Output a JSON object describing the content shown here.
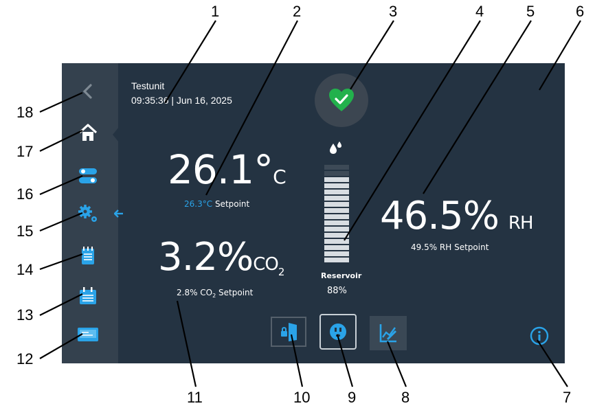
{
  "header": {
    "device_name": "Testunit",
    "datetime": "09:35:36 | Jun 16, 2025"
  },
  "temperature": {
    "value": "26.1°",
    "unit": "C",
    "setpoint_value": "26.3°C",
    "setpoint_label": "Setpoint"
  },
  "co2": {
    "value": "3.2%",
    "unit": "CO",
    "unit_sub": "2",
    "setpoint_prefix": "2.8% CO",
    "setpoint_sub": "2",
    "setpoint_suffix": " Setpoint"
  },
  "humidity": {
    "value": "46.5%",
    "unit": "RH",
    "setpoint": "49.5% RH Setpoint"
  },
  "reservoir": {
    "label": "Reservoir",
    "percent": "88%",
    "level_fraction": 0.88
  },
  "status": {
    "icon": "heart-check-icon",
    "color": "#22b14c"
  },
  "sidebar": {
    "items": [
      {
        "icon": "back-chevron-icon"
      },
      {
        "icon": "home-icon"
      },
      {
        "icon": "toggle-settings-icon"
      },
      {
        "icon": "gears-icon"
      },
      {
        "icon": "notepad-icon"
      },
      {
        "icon": "calendar-list-icon"
      },
      {
        "icon": "screen-icon"
      }
    ]
  },
  "bottom_buttons": [
    {
      "icon": "door-lock-icon"
    },
    {
      "icon": "outlet-icon"
    },
    {
      "icon": "chart-edit-icon"
    }
  ],
  "info": {
    "icon": "info-icon"
  },
  "callouts": [
    "1",
    "2",
    "3",
    "4",
    "5",
    "6",
    "7",
    "8",
    "9",
    "10",
    "11",
    "12",
    "13",
    "14",
    "15",
    "16",
    "17",
    "18"
  ],
  "colors": {
    "panel": "#243342",
    "sidebar": "#34414e",
    "accent": "#2aa3e8",
    "status_green": "#22b14c"
  }
}
